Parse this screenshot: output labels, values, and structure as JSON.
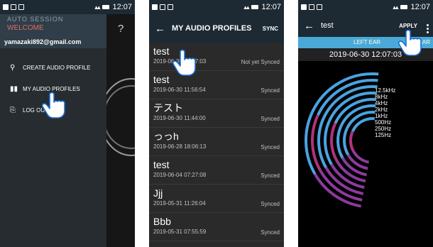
{
  "status": {
    "time": "12:07"
  },
  "drawer": {
    "brand": "AUTO SESSION",
    "welcome": "WELCOME",
    "email": "yamazaki892@gmail.com",
    "items": [
      {
        "label": "CREATE AUDIO PROFILE",
        "icon": "audio-profile-icon"
      },
      {
        "label": "MY AUDIO PROFILES",
        "icon": "bar-chart-icon"
      },
      {
        "label": "LOG OUT",
        "icon": "logout-icon"
      }
    ],
    "help_symbol": "?"
  },
  "profiles_screen": {
    "title": "MY AUDIO PROFILES",
    "action": "SYNC",
    "profiles": [
      {
        "name": "test",
        "date": "2019-06-30 12:07:03",
        "status": "Not yet Synced"
      },
      {
        "name": "test",
        "date": "2019-06-30 11:56:54",
        "status": "Synced"
      },
      {
        "name": "テスト",
        "date": "2019-06-30 11:44:00",
        "status": "Synced"
      },
      {
        "name": "っっh",
        "date": "2019-06-28 18:06:13",
        "status": "Synced"
      },
      {
        "name": "test",
        "date": "2019-06-04 07:27:08",
        "status": "Synced"
      },
      {
        "name": "Jjj",
        "date": "2019-05-31 11:26:04",
        "status": "Synced"
      },
      {
        "name": "Bbb",
        "date": "2019-05-31 07:55:59",
        "status": "Synced"
      }
    ]
  },
  "detail_screen": {
    "title": "test",
    "action": "APPLY",
    "tab_left": "LEFT EAR",
    "tab_right": "EAR",
    "date": "2019-06-30 12:07:03",
    "bands": [
      "12.5kHz",
      "8kHz",
      "4kHz",
      "2kHz",
      "1kHz",
      "500Hz",
      "250Hz",
      "125Hz"
    ],
    "colors": {
      "blue": "#4aa3e0",
      "purple": "#8c3a9c",
      "magenta": "#b0337a"
    }
  },
  "colors": {
    "toolbar": "#1d2a33",
    "drawer": "#272c31",
    "accent": "#4aa9d6",
    "welcome": "#e26a6a"
  }
}
